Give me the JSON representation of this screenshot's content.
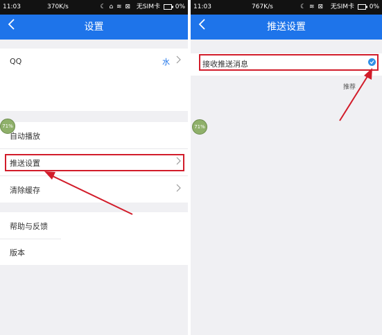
{
  "left": {
    "status": {
      "time": "11:03",
      "speed": "370K/s",
      "sim": "无SIM卡",
      "battery": "0%"
    },
    "header": {
      "title": "设置"
    },
    "rows": {
      "qq": {
        "label": "QQ",
        "value": "水"
      },
      "autoplay": {
        "label": "自动播放"
      },
      "push": {
        "label": "推送设置"
      },
      "cache": {
        "label": "清除缓存"
      },
      "help": {
        "label": "帮助与反馈"
      },
      "version": {
        "label": "版本"
      }
    },
    "badge": "71%"
  },
  "right": {
    "status": {
      "time": "11:03",
      "speed": "767K/s",
      "sim": "无SIM卡",
      "battery": "0%"
    },
    "header": {
      "title": "推送设置"
    },
    "rows": {
      "receive": {
        "label": "接收推送消息"
      }
    },
    "hint": "推荐",
    "badge": "71%"
  },
  "colors": {
    "header": "#1e74ea",
    "statusbar": "#121212",
    "highlight": "#d21c2a",
    "check": "#2f8fe6"
  },
  "icons": [
    "back-icon",
    "chevron-right-icon",
    "check-icon",
    "wifi-icon",
    "battery-icon"
  ]
}
